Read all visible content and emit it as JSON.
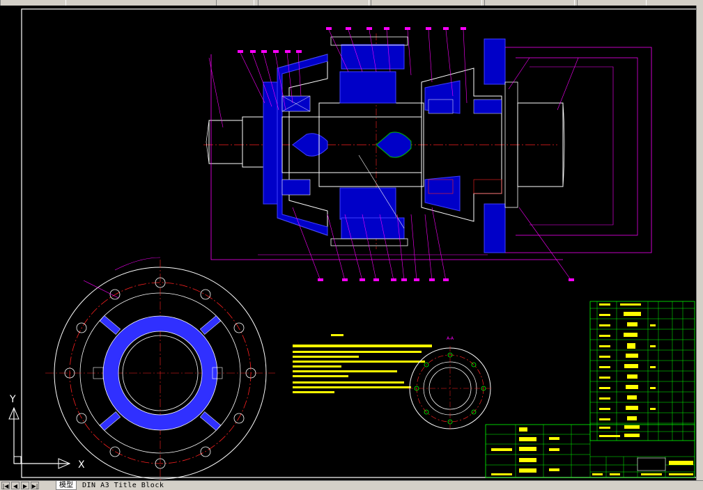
{
  "toolbar": {
    "field1": "",
    "field2": "",
    "field3": "",
    "field4": ""
  },
  "ucs": {
    "x_label": "X",
    "y_label": "Y"
  },
  "layout_tabs": {
    "nav": [
      "|◀",
      "◀",
      "▶",
      "▶|"
    ],
    "model_tab": "模型",
    "layout_tab": "DIN A3 Title Block"
  },
  "drawing": {
    "section_label": "A-A",
    "colors": {
      "frame": "#ffffff",
      "part_fill": "#0000c8",
      "part_edge": "#4040ff",
      "leader": "#ff00ff",
      "center": "#ff2020",
      "dimension": "#ff00ff",
      "hatch": "#5050ff",
      "notes": "#ffff00",
      "titleblock": "#00ff00",
      "titleblock_text": "#ffff00"
    }
  }
}
